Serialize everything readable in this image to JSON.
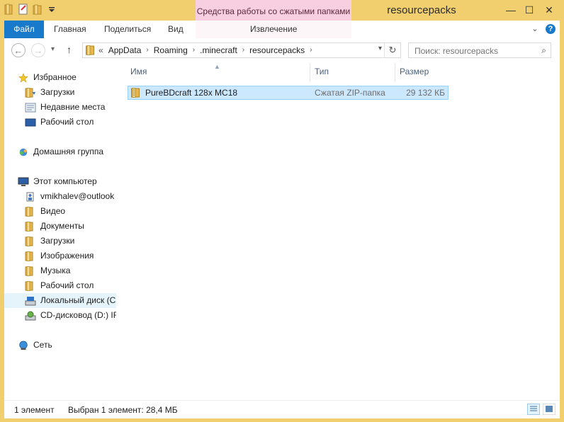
{
  "titlebar": {
    "context_tab": "Средства работы со сжатыми папками",
    "title": "resourcepacks",
    "minimize": "—",
    "maximize": "☐",
    "close": "✕"
  },
  "ribbon": {
    "file": "Файл",
    "tabs": [
      "Главная",
      "Поделиться",
      "Вид"
    ],
    "context": "Извлечение",
    "collapse": "⌄",
    "help": "?"
  },
  "navigation": {
    "back": "←",
    "forward": "→",
    "recent": "▾",
    "up": "↑",
    "refresh": "↻",
    "address": {
      "overflow": "«",
      "crumbs": [
        "AppData",
        "Roaming",
        ".minecraft",
        "resourcepacks"
      ]
    },
    "search_placeholder": "Поиск: resourcepacks"
  },
  "sidebar": {
    "favorites": {
      "label": "Избранное",
      "items": [
        "Загрузки",
        "Недавние места",
        "Рабочий стол"
      ]
    },
    "homegroup": "Домашняя группа",
    "computer": {
      "label": "Этот компьютер",
      "items": [
        "vmikhalev@outlook",
        "Видео",
        "Документы",
        "Загрузки",
        "Изображения",
        "Музыка",
        "Рабочий стол",
        "Локальный диск (C",
        "CD-дисковод (D:) IR"
      ]
    },
    "network": "Сеть"
  },
  "columns": {
    "name": "Имя",
    "type": "Тип",
    "size": "Размер"
  },
  "files": [
    {
      "name": "PureBDcraft 128x MC18",
      "type": "Сжатая ZIP-папка",
      "size": "29 132 КБ"
    }
  ],
  "statusbar": {
    "count": "1 элемент",
    "selection": "Выбран 1 элемент: 28,4 МБ"
  },
  "colors": {
    "frame": "#f1cf6e",
    "accent": "#1979ca",
    "context_tab": "#f7cfe0",
    "selection": "#cce8ff"
  }
}
